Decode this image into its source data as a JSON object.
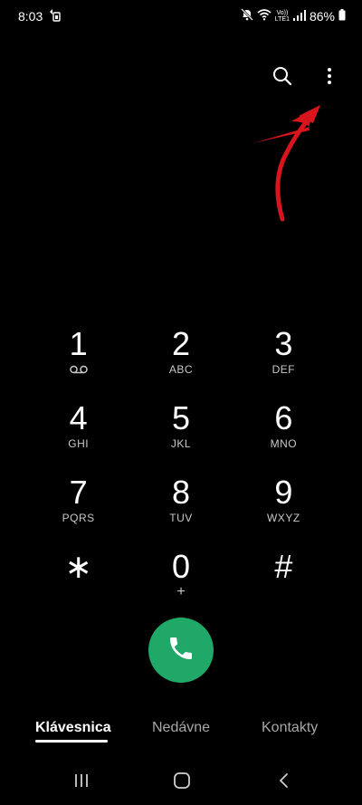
{
  "status_bar": {
    "time": "8:03",
    "lte_top": "Vo))",
    "lte_bottom": "LTE1",
    "battery_percent": "86%"
  },
  "top_actions": {
    "search_icon": "search-icon",
    "more_icon": "more-vert-icon"
  },
  "keypad": {
    "keys": [
      {
        "digit": "1",
        "letters": ""
      },
      {
        "digit": "2",
        "letters": "ABC"
      },
      {
        "digit": "3",
        "letters": "DEF"
      },
      {
        "digit": "4",
        "letters": "GHI"
      },
      {
        "digit": "5",
        "letters": "JKL"
      },
      {
        "digit": "6",
        "letters": "MNO"
      },
      {
        "digit": "7",
        "letters": "PQRS"
      },
      {
        "digit": "8",
        "letters": "TUV"
      },
      {
        "digit": "9",
        "letters": "WXYZ"
      },
      {
        "digit": "∗",
        "letters": ""
      },
      {
        "digit": "0",
        "letters": "+"
      },
      {
        "digit": "#",
        "letters": ""
      }
    ]
  },
  "call_button": {
    "icon": "phone-icon",
    "color": "#1fa868"
  },
  "tabs": [
    {
      "label": "Klávesnica",
      "active": true
    },
    {
      "label": "Nedávne",
      "active": false
    },
    {
      "label": "Kontakty",
      "active": false
    }
  ],
  "nav_bar": {
    "recents_icon": "recents-icon",
    "home_icon": "home-icon",
    "back_icon": "back-icon"
  },
  "colors": {
    "background": "#000000",
    "accent_green": "#1fa868",
    "annotation_red": "#d8141c"
  }
}
